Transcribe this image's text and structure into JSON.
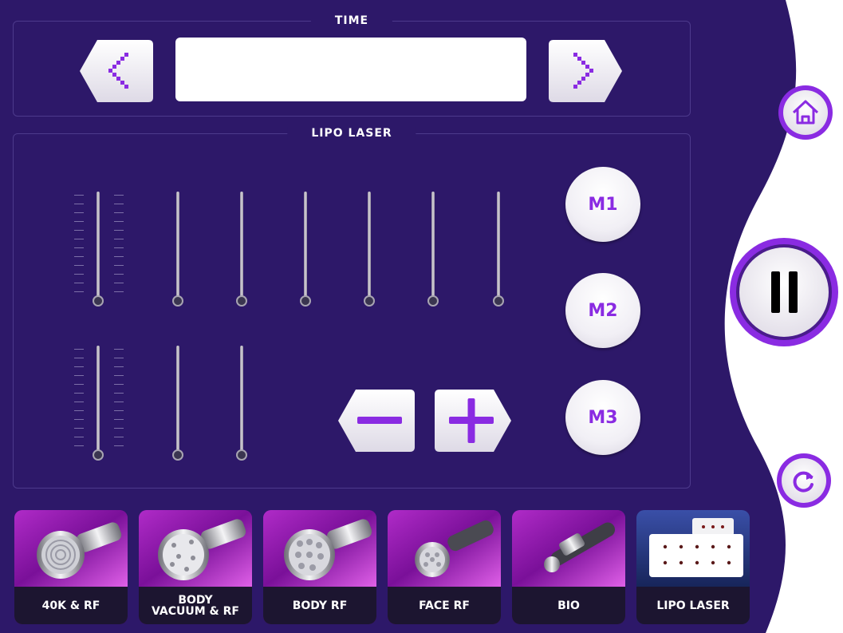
{
  "colors": {
    "panel_bg": "#2d1869",
    "accent": "#8a2be2",
    "tile_purple": "#7e14a6",
    "tile_label_bg": "#1c1530",
    "active_tile_bg": "#1b2a5e"
  },
  "time_section": {
    "title": "TIME",
    "value": "",
    "prev_icon": "chevron-left-icon",
    "next_icon": "chevron-right-icon"
  },
  "lipo_section": {
    "title": "LIPO LASER",
    "sliders_row1": [
      0,
      0,
      0,
      0,
      0,
      0,
      0
    ],
    "sliders_row2": [
      0,
      0,
      0
    ],
    "memory_buttons": [
      "M1",
      "M2",
      "M3"
    ],
    "decrease_icon": "minus-icon",
    "increase_icon": "plus-icon"
  },
  "side_controls": {
    "home_icon": "home-icon",
    "pause_icon": "pause-icon",
    "reset_icon": "refresh-icon"
  },
  "modes": [
    {
      "label": "40K & RF",
      "icon": "cavitation-handpiece-icon"
    },
    {
      "label": "BODY\nVACUUM & RF",
      "icon": "vacuum-handpiece-icon"
    },
    {
      "label": "BODY RF",
      "icon": "body-rf-handpiece-icon"
    },
    {
      "label": "FACE RF",
      "icon": "face-rf-handpiece-icon"
    },
    {
      "label": "BIO",
      "icon": "bio-handpiece-icon"
    },
    {
      "label": "LIPO LASER",
      "icon": "lipo-laser-pad-icon",
      "active": true
    }
  ]
}
